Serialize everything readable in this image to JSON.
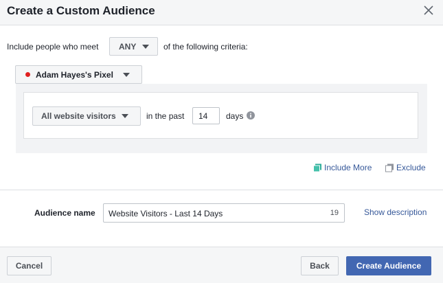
{
  "dialog": {
    "title": "Create a Custom Audience"
  },
  "criteria": {
    "prefix": "Include people who meet",
    "match_value": "ANY",
    "suffix": "of the following criteria:"
  },
  "pixel": {
    "name": "Adam Hayes's Pixel",
    "status_color": "#e02020"
  },
  "rule": {
    "traffic_value": "All website visitors",
    "in_the_past_label": "in the past",
    "days_value": "14",
    "days_label": "days"
  },
  "links": {
    "include_more": "Include More",
    "exclude": "Exclude"
  },
  "audience": {
    "label": "Audience name",
    "value": "Website Visitors - Last 14 Days",
    "char_count": "19",
    "show_description": "Show description"
  },
  "footer": {
    "cancel": "Cancel",
    "back": "Back",
    "create": "Create Audience"
  },
  "colors": {
    "primary": "#4267b2",
    "link": "#365899"
  }
}
